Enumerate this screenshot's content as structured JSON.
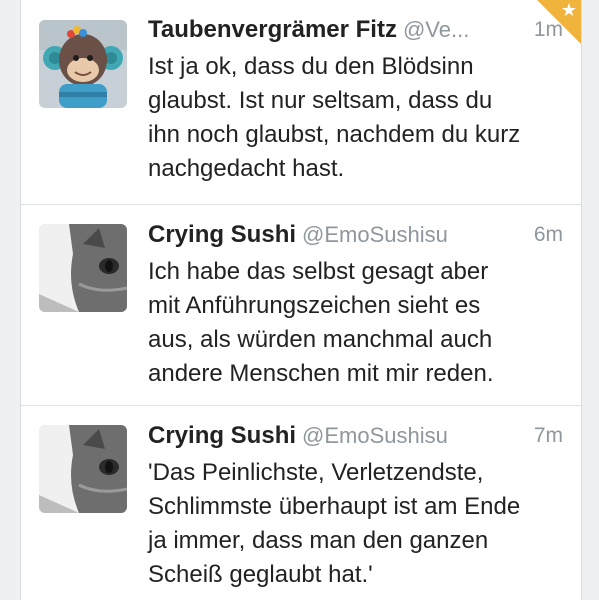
{
  "tweets": [
    {
      "name": "Taubenvergrämer Fitz",
      "handle": "@Ve...",
      "time": "1m",
      "text": "Ist ja ok, dass du den Blödsinn\nglaubst. Ist nur seltsam, dass du\nihn noch glaubst, nachdem du kurz\nnachgedacht hast.",
      "avatar": "monkey-toy-avatar",
      "favorited": true
    },
    {
      "name": "Crying Sushi",
      "handle": "@EmoSushisu",
      "time": "6m",
      "text": "Ich habe das selbst gesagt aber\nmit Anführungszeichen sieht es\naus, als würden manchmal auch\nandere Menschen mit mir reden.",
      "avatar": "cat-photo-avatar"
    },
    {
      "name": "Crying Sushi",
      "handle": "@EmoSushisu",
      "time": "7m",
      "text": "'Das Peinlichste, Verletzendste,\nSchlimmste überhaupt ist am Ende\nja immer, dass man den ganzen\nScheiß geglaubt hat.'",
      "avatar": "cat-photo-avatar"
    }
  ],
  "colors": {
    "favorite_corner": "#f0b43c",
    "text": "#222222",
    "meta": "#8f979e"
  }
}
